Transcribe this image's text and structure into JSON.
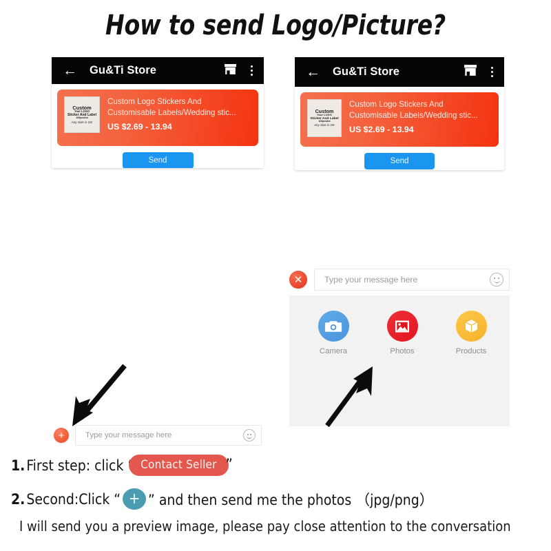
{
  "title": "How to send Logo/Picture?",
  "phone_cards": [
    {
      "appbar": {
        "back_icon": "arrow-left-icon",
        "store_name": "Gu&Ti Store",
        "shop_icon": "shop-icon",
        "menu_icon": "more-vertical-icon"
      },
      "product": {
        "name": "Custom Logo Stickers And Customisable Labels/Wedding stic...",
        "price": "US $2.69 - 13.94",
        "thumbnail": {
          "line1": "Custom",
          "line2": "Your LOGO",
          "line3": "Sticker And Label",
          "line4": "100pcs/lot",
          "line5": "Any Size is OK"
        }
      },
      "send_label": "Send"
    },
    {
      "appbar": {
        "back_icon": "arrow-left-icon",
        "store_name": "Gu&Ti Store",
        "shop_icon": "shop-icon",
        "menu_icon": "more-vertical-icon"
      },
      "product": {
        "name": "Custom Logo Stickers And Customisable Labels/Wedding stic...",
        "price": "US $2.69 - 13.94",
        "thumbnail": {
          "line1": "Custom",
          "line2": "Your LOGO",
          "line3": "Sticker And Label",
          "line4": "100pcs/lot",
          "line5": "Any Size is OK"
        }
      },
      "send_label": "Send"
    }
  ],
  "chat_expanded": {
    "close_icon": "close-icon",
    "close_glyph": "✕",
    "input_placeholder": "Type your message here",
    "emoji_icon": "smiley-icon",
    "attachments": [
      {
        "label": "Camera",
        "icon": "camera-icon",
        "color": "#4a93dd"
      },
      {
        "label": "Photos",
        "icon": "photo-icon",
        "color": "#e1151f"
      },
      {
        "label": "Products",
        "icon": "box-icon",
        "color": "#f5b22a"
      }
    ]
  },
  "chat_collapsed": {
    "plus_icon": "plus-icon",
    "plus_glyph": "+",
    "input_placeholder": "Type your message here",
    "emoji_icon": "smiley-icon"
  },
  "instructions": {
    "step1": {
      "number": "1.",
      "text_before": "First step: click “",
      "pill_label": "Contact Seller",
      "text_after": "”"
    },
    "step2": {
      "number": "2.",
      "text_before": "Second:Click “",
      "badge_glyph": "+",
      "text_after": "” and then send me the photos （jpg/png）"
    },
    "note": "I will send you a preview image, please pay close attention to the conversation"
  },
  "colors": {
    "banner_orange": "#f4330f",
    "send_blue": "#1a96f0",
    "pill_red": "#e3574e",
    "plus_teal": "#4b9cb0",
    "panel_gray": "#f2f2f2"
  }
}
